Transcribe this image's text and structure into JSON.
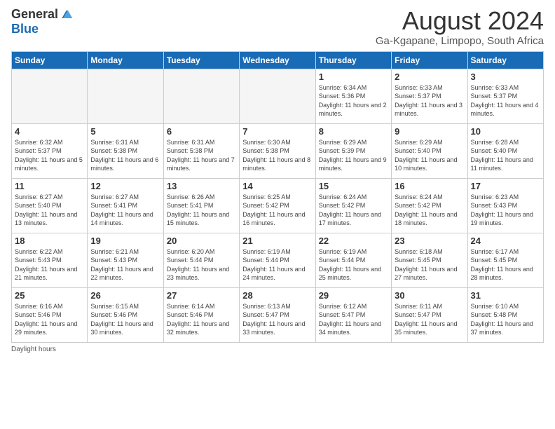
{
  "logo": {
    "general": "General",
    "blue": "Blue"
  },
  "title": "August 2024",
  "subtitle": "Ga-Kgapane, Limpopo, South Africa",
  "days_header": [
    "Sunday",
    "Monday",
    "Tuesday",
    "Wednesday",
    "Thursday",
    "Friday",
    "Saturday"
  ],
  "weeks": [
    [
      {
        "day": "",
        "info": "",
        "empty": true
      },
      {
        "day": "",
        "info": "",
        "empty": true
      },
      {
        "day": "",
        "info": "",
        "empty": true
      },
      {
        "day": "",
        "info": "",
        "empty": true
      },
      {
        "day": "1",
        "info": "Sunrise: 6:34 AM\nSunset: 5:36 PM\nDaylight: 11 hours and 2 minutes."
      },
      {
        "day": "2",
        "info": "Sunrise: 6:33 AM\nSunset: 5:37 PM\nDaylight: 11 hours and 3 minutes."
      },
      {
        "day": "3",
        "info": "Sunrise: 6:33 AM\nSunset: 5:37 PM\nDaylight: 11 hours and 4 minutes."
      }
    ],
    [
      {
        "day": "4",
        "info": "Sunrise: 6:32 AM\nSunset: 5:37 PM\nDaylight: 11 hours and 5 minutes."
      },
      {
        "day": "5",
        "info": "Sunrise: 6:31 AM\nSunset: 5:38 PM\nDaylight: 11 hours and 6 minutes."
      },
      {
        "day": "6",
        "info": "Sunrise: 6:31 AM\nSunset: 5:38 PM\nDaylight: 11 hours and 7 minutes."
      },
      {
        "day": "7",
        "info": "Sunrise: 6:30 AM\nSunset: 5:38 PM\nDaylight: 11 hours and 8 minutes."
      },
      {
        "day": "8",
        "info": "Sunrise: 6:29 AM\nSunset: 5:39 PM\nDaylight: 11 hours and 9 minutes."
      },
      {
        "day": "9",
        "info": "Sunrise: 6:29 AM\nSunset: 5:40 PM\nDaylight: 11 hours and 10 minutes."
      },
      {
        "day": "10",
        "info": "Sunrise: 6:28 AM\nSunset: 5:40 PM\nDaylight: 11 hours and 11 minutes."
      }
    ],
    [
      {
        "day": "11",
        "info": "Sunrise: 6:27 AM\nSunset: 5:40 PM\nDaylight: 11 hours and 13 minutes."
      },
      {
        "day": "12",
        "info": "Sunrise: 6:27 AM\nSunset: 5:41 PM\nDaylight: 11 hours and 14 minutes."
      },
      {
        "day": "13",
        "info": "Sunrise: 6:26 AM\nSunset: 5:41 PM\nDaylight: 11 hours and 15 minutes."
      },
      {
        "day": "14",
        "info": "Sunrise: 6:25 AM\nSunset: 5:42 PM\nDaylight: 11 hours and 16 minutes."
      },
      {
        "day": "15",
        "info": "Sunrise: 6:24 AM\nSunset: 5:42 PM\nDaylight: 11 hours and 17 minutes."
      },
      {
        "day": "16",
        "info": "Sunrise: 6:24 AM\nSunset: 5:42 PM\nDaylight: 11 hours and 18 minutes."
      },
      {
        "day": "17",
        "info": "Sunrise: 6:23 AM\nSunset: 5:43 PM\nDaylight: 11 hours and 19 minutes."
      }
    ],
    [
      {
        "day": "18",
        "info": "Sunrise: 6:22 AM\nSunset: 5:43 PM\nDaylight: 11 hours and 21 minutes."
      },
      {
        "day": "19",
        "info": "Sunrise: 6:21 AM\nSunset: 5:43 PM\nDaylight: 11 hours and 22 minutes."
      },
      {
        "day": "20",
        "info": "Sunrise: 6:20 AM\nSunset: 5:44 PM\nDaylight: 11 hours and 23 minutes."
      },
      {
        "day": "21",
        "info": "Sunrise: 6:19 AM\nSunset: 5:44 PM\nDaylight: 11 hours and 24 minutes."
      },
      {
        "day": "22",
        "info": "Sunrise: 6:19 AM\nSunset: 5:44 PM\nDaylight: 11 hours and 25 minutes."
      },
      {
        "day": "23",
        "info": "Sunrise: 6:18 AM\nSunset: 5:45 PM\nDaylight: 11 hours and 27 minutes."
      },
      {
        "day": "24",
        "info": "Sunrise: 6:17 AM\nSunset: 5:45 PM\nDaylight: 11 hours and 28 minutes."
      }
    ],
    [
      {
        "day": "25",
        "info": "Sunrise: 6:16 AM\nSunset: 5:46 PM\nDaylight: 11 hours and 29 minutes."
      },
      {
        "day": "26",
        "info": "Sunrise: 6:15 AM\nSunset: 5:46 PM\nDaylight: 11 hours and 30 minutes."
      },
      {
        "day": "27",
        "info": "Sunrise: 6:14 AM\nSunset: 5:46 PM\nDaylight: 11 hours and 32 minutes."
      },
      {
        "day": "28",
        "info": "Sunrise: 6:13 AM\nSunset: 5:47 PM\nDaylight: 11 hours and 33 minutes."
      },
      {
        "day": "29",
        "info": "Sunrise: 6:12 AM\nSunset: 5:47 PM\nDaylight: 11 hours and 34 minutes."
      },
      {
        "day": "30",
        "info": "Sunrise: 6:11 AM\nSunset: 5:47 PM\nDaylight: 11 hours and 35 minutes."
      },
      {
        "day": "31",
        "info": "Sunrise: 6:10 AM\nSunset: 5:48 PM\nDaylight: 11 hours and 37 minutes."
      }
    ]
  ],
  "footer": "Daylight hours"
}
